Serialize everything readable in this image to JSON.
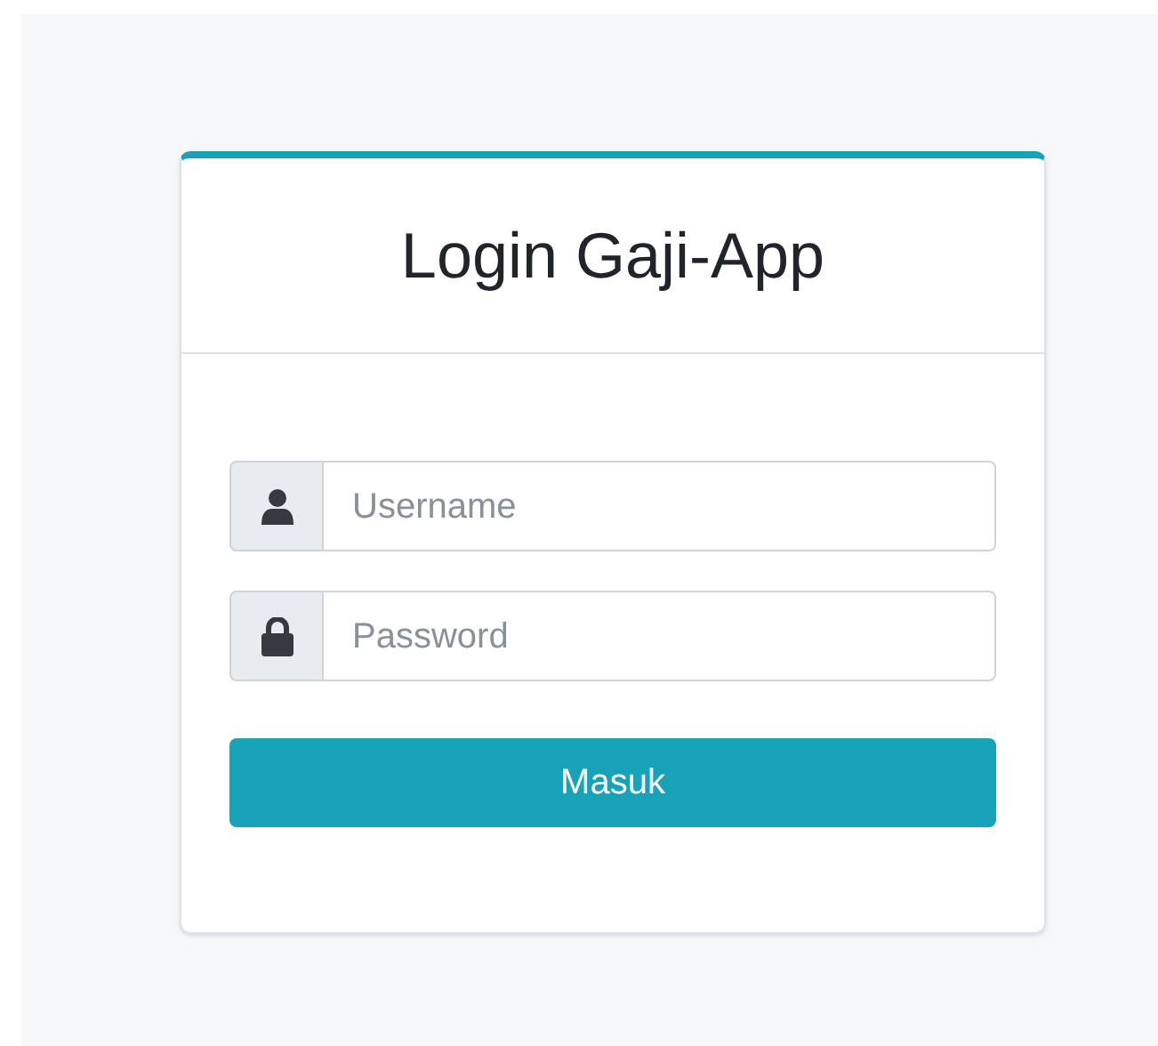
{
  "login_card": {
    "title": "Login Gaji-App",
    "fields": [
      {
        "kind": "user",
        "placeholder": "Username"
      },
      {
        "kind": "lock",
        "placeholder": "Password"
      }
    ],
    "submit_button": "Masuk"
  }
}
